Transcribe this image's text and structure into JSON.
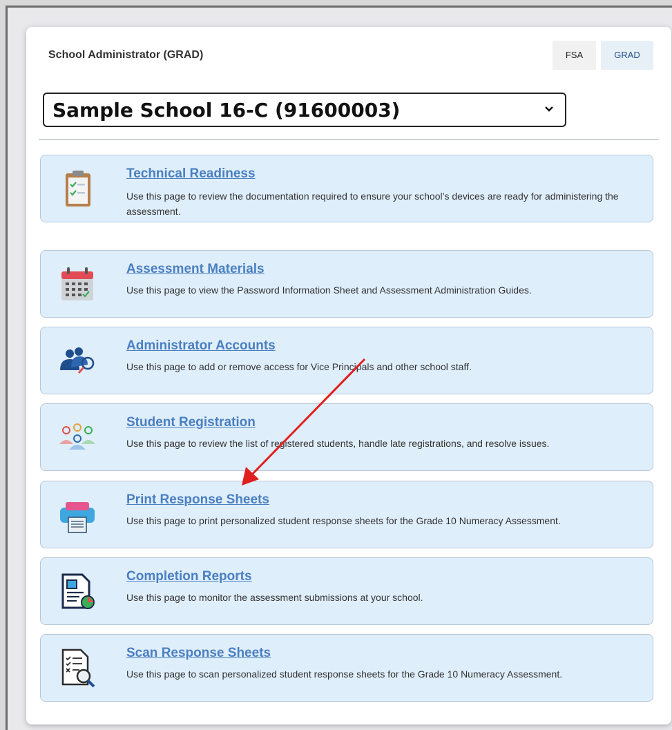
{
  "header": {
    "role_title": "School Administrator (GRAD)",
    "toggle_fsa": "FSA",
    "toggle_grad": "GRAD"
  },
  "school_select": {
    "selected": "Sample School 16-C (91600003)"
  },
  "items": [
    {
      "title": "Technical Readiness",
      "desc": "Use this page to review the documentation required to ensure your school’s devices are ready for administering the assessment.",
      "icon": "clipboard-checklist-icon"
    },
    {
      "title": "Assessment Materials",
      "desc": "Use this page to view the Password Information Sheet and Assessment Administration Guides.",
      "icon": "calendar-icon"
    },
    {
      "title": "Administrator Accounts",
      "desc": "Use this page to add or remove access for Vice Principals and other school staff.",
      "icon": "users-search-icon"
    },
    {
      "title": "Student Registration",
      "desc": "Use this page to review the list of registered students, handle late registrations, and resolve issues.",
      "icon": "student-group-icon"
    },
    {
      "title": "Print Response Sheets",
      "desc": "Use this page to print personalized student response sheets for the Grade 10 Numeracy Assessment.",
      "icon": "printer-icon"
    },
    {
      "title": "Completion Reports",
      "desc": "Use this page to monitor the assessment submissions at your school.",
      "icon": "report-chart-icon"
    },
    {
      "title": "Scan Response Sheets",
      "desc": "Use this page to scan personalized student response sheets for the Grade 10 Numeracy Assessment.",
      "icon": "document-search-icon"
    }
  ],
  "colors": {
    "link": "#4a7fc1",
    "item_bg": "#dfeefb",
    "annotation_arrow": "#e02020"
  }
}
